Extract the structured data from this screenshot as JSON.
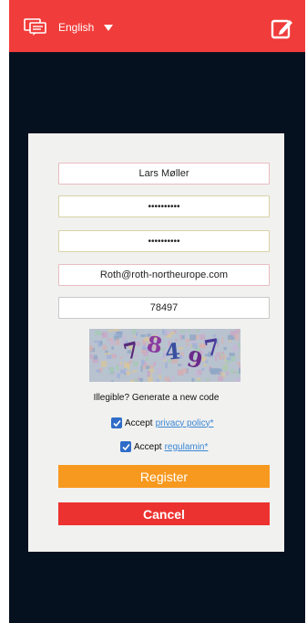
{
  "topbar": {
    "language": "English",
    "icons": {
      "language": "chat-bubbles-icon",
      "dropdown": "caret-down-icon",
      "edit": "edit-square-icon"
    },
    "background": "#f03c3a"
  },
  "form": {
    "name_value": "Lars Møller",
    "password_value": "••••••••••",
    "confirm_password_value": "••••••••••",
    "email_value": "Roth@roth-northeurope.com",
    "captcha_input_value": "78497",
    "captcha_image_text": "78497",
    "new_code_text": "Illegible? Generate a new code",
    "accept_privacy": {
      "checked": true,
      "label": "Accept",
      "link": "privacy policy*"
    },
    "accept_regulamin": {
      "checked": true,
      "label": "Accept",
      "link": "regulamin*"
    },
    "register_label": "Register",
    "cancel_label": "Cancel"
  },
  "colors": {
    "screen_background": "#06111f",
    "card_background": "#f1f1ef",
    "register": "#f7991f",
    "cancel": "#ec3230",
    "link": "#3a86d6"
  }
}
